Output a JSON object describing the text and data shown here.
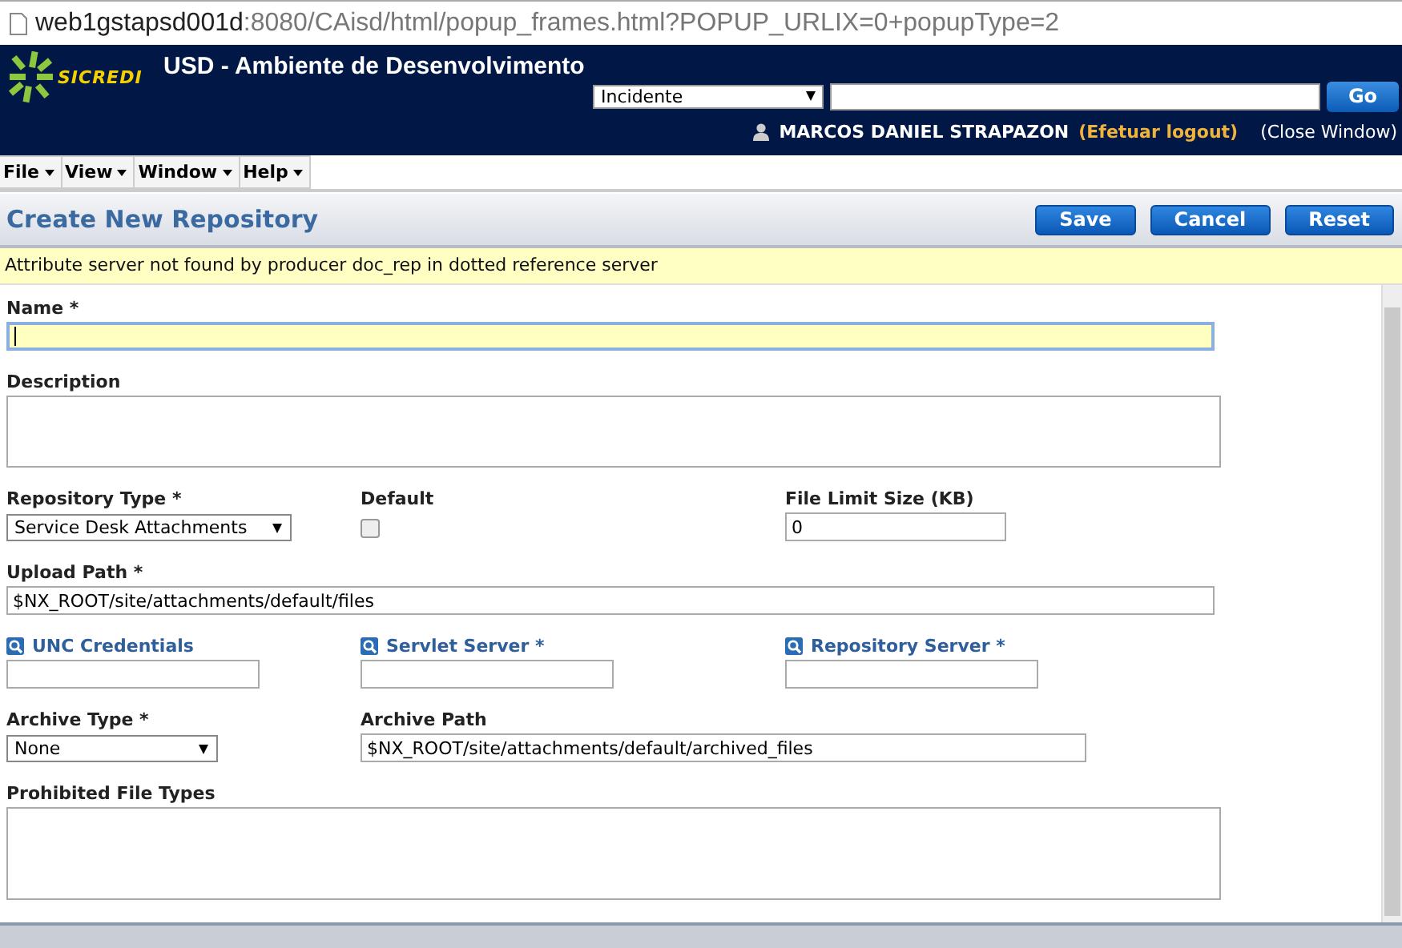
{
  "address_bar": {
    "host": "web1gstapsd001d",
    "path": ":8080/CAisd/html/popup_frames.html?POPUP_URLIX=0+popupType=2"
  },
  "header": {
    "logo_text": "SICREDI",
    "title": "USD - Ambiente de Desenvolvimento",
    "search_type": "Incidente",
    "go_button": "Go",
    "user": "MARCOS DANIEL STRAPAZON",
    "logout": "(Efetuar logout)",
    "close_window": "(Close Window)"
  },
  "menu": [
    "File",
    "View",
    "Window",
    "Help"
  ],
  "page": {
    "title": "Create New Repository",
    "buttons": [
      "Save",
      "Cancel",
      "Reset"
    ],
    "message": "Attribute server not found by producer doc_rep in dotted reference server"
  },
  "form": {
    "rows": [
      {
        "fields": [
          {
            "kind": "text",
            "label": "Name *",
            "focused": true
          }
        ]
      },
      {
        "fields": [
          {
            "kind": "textarea",
            "label": "Description"
          }
        ]
      },
      {
        "fields": [
          {
            "kind": "select",
            "label": "Repository Type *",
            "value": "Service Desk Attachments"
          },
          {
            "kind": "checkbox",
            "label": "Default",
            "checked": false
          },
          {
            "kind": "text",
            "label": "File Limit Size (KB)",
            "value": "0",
            "focused": false
          }
        ]
      },
      {
        "fields": [
          {
            "kind": "text",
            "label": "Upload Path *",
            "value": "$NX_ROOT/site/attachments/default/files",
            "focused": false
          }
        ]
      },
      {
        "fields": [
          {
            "kind": "lookup",
            "label": "UNC Credentials"
          },
          {
            "kind": "lookup",
            "label": "Servlet Server *"
          },
          {
            "kind": "lookup",
            "label": "Repository Server *"
          }
        ]
      },
      {
        "fields": [
          {
            "kind": "select",
            "label": "Archive Type *",
            "value": "None"
          },
          {
            "kind": "text",
            "label": "Archive Path",
            "value": "$NX_ROOT/site/attachments/default/archived_files",
            "focused": false
          }
        ]
      },
      {
        "fields": [
          {
            "kind": "textarea",
            "label": "Prohibited File Types"
          }
        ]
      }
    ]
  }
}
